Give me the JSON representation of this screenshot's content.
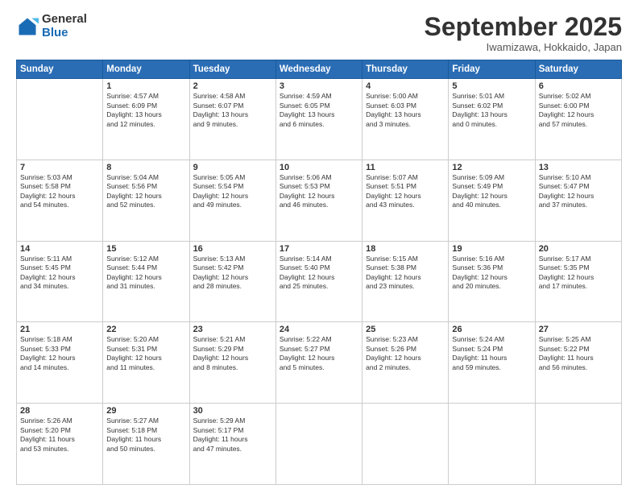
{
  "header": {
    "logo_line1": "General",
    "logo_line2": "Blue",
    "month": "September 2025",
    "location": "Iwamizawa, Hokkaido, Japan"
  },
  "weekdays": [
    "Sunday",
    "Monday",
    "Tuesday",
    "Wednesday",
    "Thursday",
    "Friday",
    "Saturday"
  ],
  "weeks": [
    [
      {
        "day": "",
        "info": ""
      },
      {
        "day": "1",
        "info": "Sunrise: 4:57 AM\nSunset: 6:09 PM\nDaylight: 13 hours\nand 12 minutes."
      },
      {
        "day": "2",
        "info": "Sunrise: 4:58 AM\nSunset: 6:07 PM\nDaylight: 13 hours\nand 9 minutes."
      },
      {
        "day": "3",
        "info": "Sunrise: 4:59 AM\nSunset: 6:05 PM\nDaylight: 13 hours\nand 6 minutes."
      },
      {
        "day": "4",
        "info": "Sunrise: 5:00 AM\nSunset: 6:03 PM\nDaylight: 13 hours\nand 3 minutes."
      },
      {
        "day": "5",
        "info": "Sunrise: 5:01 AM\nSunset: 6:02 PM\nDaylight: 13 hours\nand 0 minutes."
      },
      {
        "day": "6",
        "info": "Sunrise: 5:02 AM\nSunset: 6:00 PM\nDaylight: 12 hours\nand 57 minutes."
      }
    ],
    [
      {
        "day": "7",
        "info": "Sunrise: 5:03 AM\nSunset: 5:58 PM\nDaylight: 12 hours\nand 54 minutes."
      },
      {
        "day": "8",
        "info": "Sunrise: 5:04 AM\nSunset: 5:56 PM\nDaylight: 12 hours\nand 52 minutes."
      },
      {
        "day": "9",
        "info": "Sunrise: 5:05 AM\nSunset: 5:54 PM\nDaylight: 12 hours\nand 49 minutes."
      },
      {
        "day": "10",
        "info": "Sunrise: 5:06 AM\nSunset: 5:53 PM\nDaylight: 12 hours\nand 46 minutes."
      },
      {
        "day": "11",
        "info": "Sunrise: 5:07 AM\nSunset: 5:51 PM\nDaylight: 12 hours\nand 43 minutes."
      },
      {
        "day": "12",
        "info": "Sunrise: 5:09 AM\nSunset: 5:49 PM\nDaylight: 12 hours\nand 40 minutes."
      },
      {
        "day": "13",
        "info": "Sunrise: 5:10 AM\nSunset: 5:47 PM\nDaylight: 12 hours\nand 37 minutes."
      }
    ],
    [
      {
        "day": "14",
        "info": "Sunrise: 5:11 AM\nSunset: 5:45 PM\nDaylight: 12 hours\nand 34 minutes."
      },
      {
        "day": "15",
        "info": "Sunrise: 5:12 AM\nSunset: 5:44 PM\nDaylight: 12 hours\nand 31 minutes."
      },
      {
        "day": "16",
        "info": "Sunrise: 5:13 AM\nSunset: 5:42 PM\nDaylight: 12 hours\nand 28 minutes."
      },
      {
        "day": "17",
        "info": "Sunrise: 5:14 AM\nSunset: 5:40 PM\nDaylight: 12 hours\nand 25 minutes."
      },
      {
        "day": "18",
        "info": "Sunrise: 5:15 AM\nSunset: 5:38 PM\nDaylight: 12 hours\nand 23 minutes."
      },
      {
        "day": "19",
        "info": "Sunrise: 5:16 AM\nSunset: 5:36 PM\nDaylight: 12 hours\nand 20 minutes."
      },
      {
        "day": "20",
        "info": "Sunrise: 5:17 AM\nSunset: 5:35 PM\nDaylight: 12 hours\nand 17 minutes."
      }
    ],
    [
      {
        "day": "21",
        "info": "Sunrise: 5:18 AM\nSunset: 5:33 PM\nDaylight: 12 hours\nand 14 minutes."
      },
      {
        "day": "22",
        "info": "Sunrise: 5:20 AM\nSunset: 5:31 PM\nDaylight: 12 hours\nand 11 minutes."
      },
      {
        "day": "23",
        "info": "Sunrise: 5:21 AM\nSunset: 5:29 PM\nDaylight: 12 hours\nand 8 minutes."
      },
      {
        "day": "24",
        "info": "Sunrise: 5:22 AM\nSunset: 5:27 PM\nDaylight: 12 hours\nand 5 minutes."
      },
      {
        "day": "25",
        "info": "Sunrise: 5:23 AM\nSunset: 5:26 PM\nDaylight: 12 hours\nand 2 minutes."
      },
      {
        "day": "26",
        "info": "Sunrise: 5:24 AM\nSunset: 5:24 PM\nDaylight: 11 hours\nand 59 minutes."
      },
      {
        "day": "27",
        "info": "Sunrise: 5:25 AM\nSunset: 5:22 PM\nDaylight: 11 hours\nand 56 minutes."
      }
    ],
    [
      {
        "day": "28",
        "info": "Sunrise: 5:26 AM\nSunset: 5:20 PM\nDaylight: 11 hours\nand 53 minutes."
      },
      {
        "day": "29",
        "info": "Sunrise: 5:27 AM\nSunset: 5:18 PM\nDaylight: 11 hours\nand 50 minutes."
      },
      {
        "day": "30",
        "info": "Sunrise: 5:29 AM\nSunset: 5:17 PM\nDaylight: 11 hours\nand 47 minutes."
      },
      {
        "day": "",
        "info": ""
      },
      {
        "day": "",
        "info": ""
      },
      {
        "day": "",
        "info": ""
      },
      {
        "day": "",
        "info": ""
      }
    ]
  ]
}
